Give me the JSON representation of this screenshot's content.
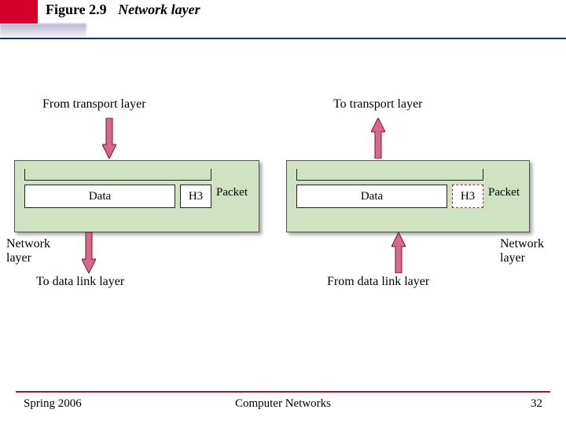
{
  "header": {
    "figure_no": "Figure 2.9",
    "figure_title": "Network layer"
  },
  "diagram": {
    "left": {
      "top_label": "From transport layer",
      "data_label": "Data",
      "header_label": "H3",
      "packet_label": "Packet",
      "layer_label": "Network layer",
      "bottom_label": "To data link layer"
    },
    "right": {
      "top_label": "To transport layer",
      "data_label": "Data",
      "header_label": "H3",
      "packet_label": "Packet",
      "layer_label": "Network layer",
      "bottom_label": "From data link layer"
    }
  },
  "footer": {
    "left": "Spring 2006",
    "center": "Computer Networks",
    "page": "32"
  },
  "colors": {
    "accent_red": "#d4002a",
    "underline_blue": "#1a2e8a",
    "panel_green": "#cfe3c2",
    "arrow_fill": "#d66a8a",
    "arrow_stroke": "#7a1030"
  }
}
